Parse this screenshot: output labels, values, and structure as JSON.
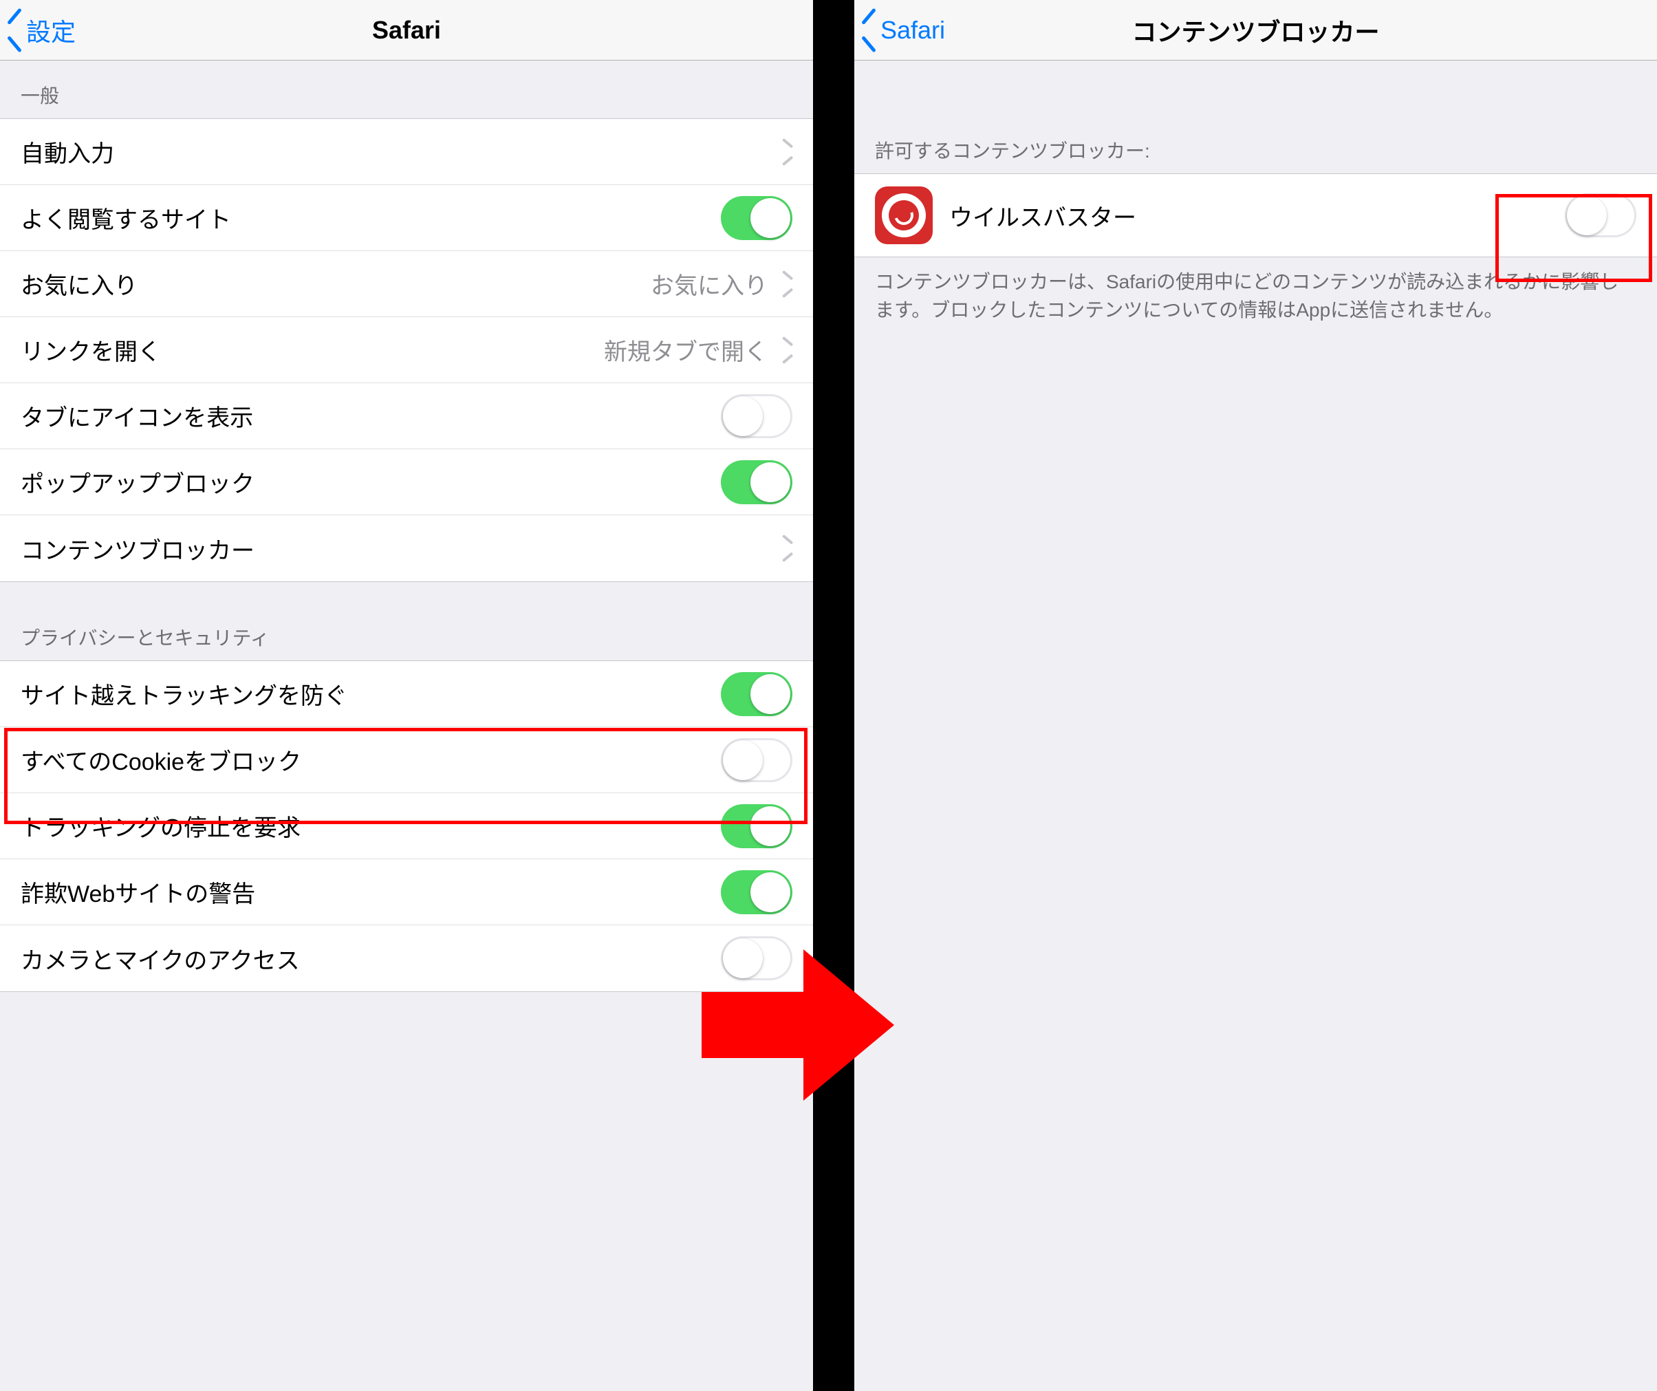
{
  "left": {
    "nav": {
      "back": "設定",
      "title": "Safari"
    },
    "section_general": "一般",
    "rows": {
      "autofill": {
        "label": "自動入力"
      },
      "freq_sites": {
        "label": "よく閲覧するサイト",
        "toggle": "on"
      },
      "favorites": {
        "label": "お気に入り",
        "detail": "お気に入り"
      },
      "open_links": {
        "label": "リンクを開く",
        "detail": "新規タブで開く"
      },
      "tab_icons": {
        "label": "タブにアイコンを表示",
        "toggle": "off"
      },
      "popup_block": {
        "label": "ポップアップブロック",
        "toggle": "on"
      },
      "content_block": {
        "label": "コンテンツブロッカー"
      }
    },
    "section_privacy": "プライバシーとセキュリティ",
    "rows2": {
      "prevent_xsite": {
        "label": "サイト越えトラッキングを防ぐ",
        "toggle": "on"
      },
      "block_cookies": {
        "label": "すべてのCookieをブロック",
        "toggle": "off"
      },
      "ask_no_track": {
        "label": "トラッキングの停止を要求",
        "toggle": "on"
      },
      "fraud_warning": {
        "label": "詐欺Webサイトの警告",
        "toggle": "on"
      },
      "camera_mic": {
        "label": "カメラとマイクのアクセス",
        "toggle": "off"
      }
    }
  },
  "right": {
    "nav": {
      "back": "Safari",
      "title": "コンテンツブロッカー"
    },
    "section_header": "許可するコンテンツブロッカー:",
    "row": {
      "label": "ウイルスバスター",
      "toggle": "off"
    },
    "footer": "コンテンツブロッカーは、Safariの使用中にどのコンテンツが読み込まれるかに影響します。ブロックしたコンテンツについての情報はAppに送信されません。"
  }
}
